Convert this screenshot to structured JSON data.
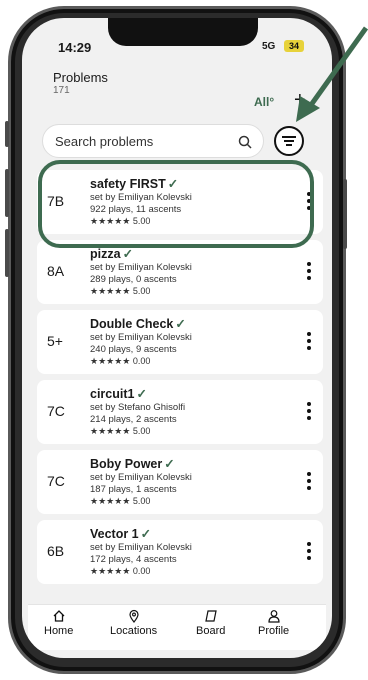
{
  "status": {
    "time": "14:29",
    "network": "5G",
    "battery": "34"
  },
  "header": {
    "title": "Problems",
    "count": "171",
    "filter_label": "All°",
    "add_label": "+"
  },
  "search": {
    "placeholder": "Search problems"
  },
  "problems": [
    {
      "grade": "7B",
      "name": "safety FIRST",
      "check": "✓",
      "setter": "set by Emiliyan Kolevski",
      "stats": "922 plays, 11 ascents",
      "rating": "★★★★★ 5.00"
    },
    {
      "grade": "8A",
      "name": "pizza",
      "check": "✓",
      "setter": "set by Emiliyan Kolevski",
      "stats": "289 plays, 0 ascents",
      "rating": "★★★★★ 5.00"
    },
    {
      "grade": "5+",
      "name": "Double Check",
      "check": "✓",
      "setter": "set by Emiliyan Kolevski",
      "stats": "240 plays, 9 ascents",
      "rating": "★★★★★ 0.00"
    },
    {
      "grade": "7C",
      "name": "circuit1",
      "check": "✓",
      "setter": "set by Stefano Ghisolfi",
      "stats": "214 plays, 2 ascents",
      "rating": "★★★★★ 5.00"
    },
    {
      "grade": "7C",
      "name": "Boby Power",
      "check": "✓",
      "setter": "set by Emiliyan Kolevski",
      "stats": "187 plays, 1 ascents",
      "rating": "★★★★★ 5.00"
    },
    {
      "grade": "6B",
      "name": "Vector 1",
      "check": "✓",
      "setter": "set by Emiliyan Kolevski",
      "stats": "172 plays, 4 ascents",
      "rating": "★★★★★ 0.00"
    }
  ],
  "nav": [
    {
      "label": "Home",
      "icon": "home-icon"
    },
    {
      "label": "Locations",
      "icon": "location-pin-icon"
    },
    {
      "label": "Board",
      "icon": "board-icon"
    },
    {
      "label": "Profile",
      "icon": "profile-icon"
    }
  ],
  "colors": {
    "accent": "#3e6b50",
    "battery": "#e7d23a",
    "background": "#f1f1f1"
  }
}
